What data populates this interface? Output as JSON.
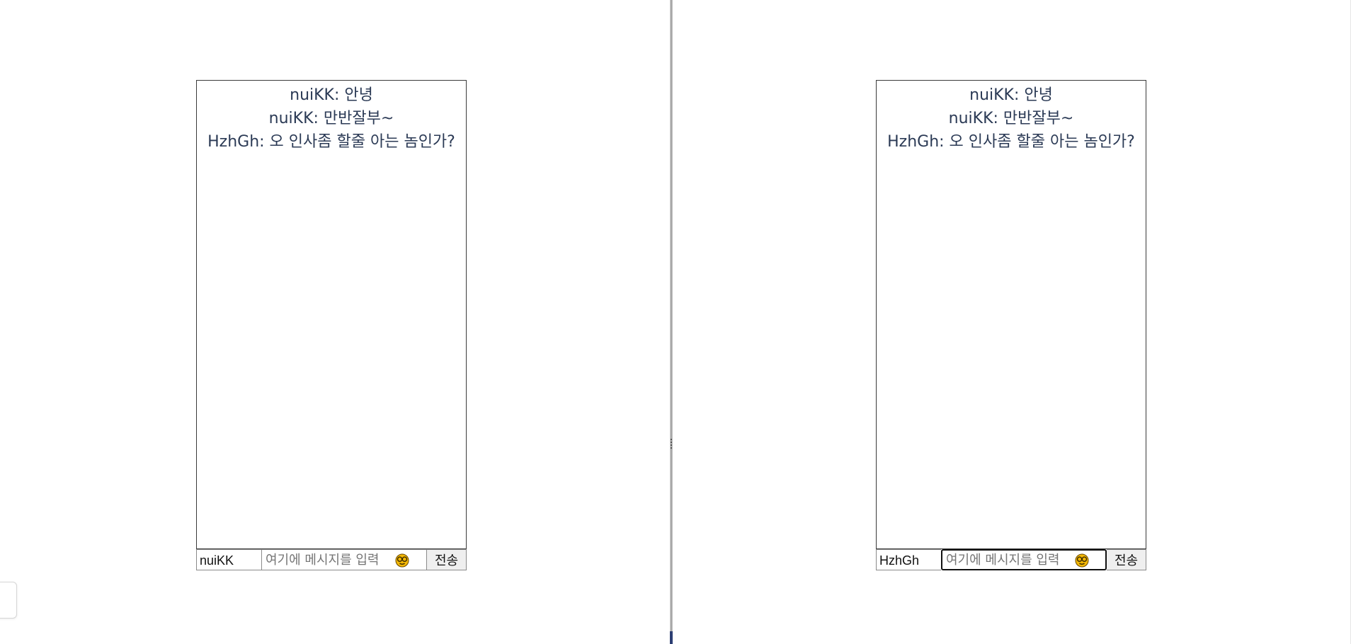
{
  "panes": [
    {
      "user_name": "nuiKK",
      "messages": [
        "nuiKK: 안녕",
        "nuiKK: 만반잘부~",
        "HzhGh: 오 인사좀 할줄 아는 놈인가?"
      ],
      "message_placeholder": "여기에 메시지를 입력",
      "send_label": "전송"
    },
    {
      "user_name": "HzhGh",
      "messages": [
        "nuiKK: 안녕",
        "nuiKK: 만반잘부~",
        "HzhGh: 오 인사좀 할줄 아는 놈인가?"
      ],
      "message_placeholder": "여기에 메시지를 입력",
      "send_label": "전송"
    }
  ],
  "icons": {
    "emoji": "emoji-picker-icon"
  },
  "colors": {
    "message_text": "#2b3a55",
    "emoji_fill": "#f2b705"
  }
}
